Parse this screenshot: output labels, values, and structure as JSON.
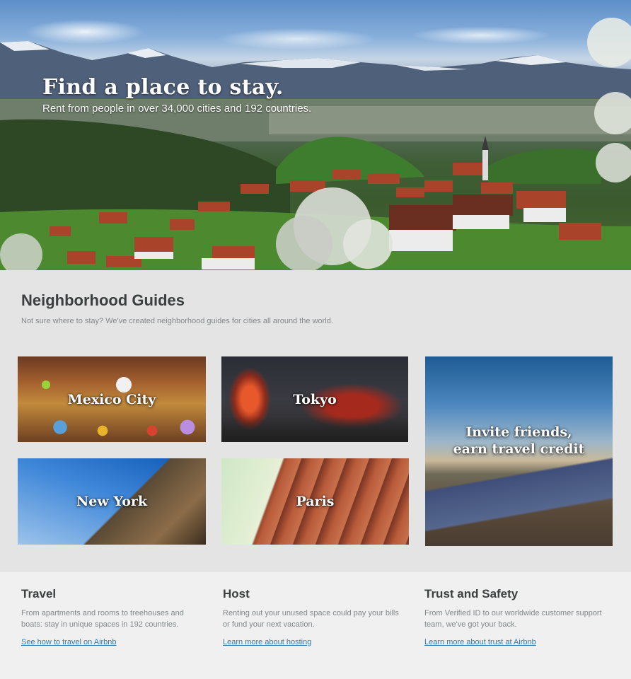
{
  "hero": {
    "title": "Find a place to stay.",
    "subtitle": "Rent from people in over 34,000 cities and 192 countries."
  },
  "neighborhood": {
    "title": "Neighborhood Guides",
    "subtitle": "Not sure where to stay? We've created neighborhood guides for cities all around the world.",
    "tiles": [
      {
        "label": "Mexico City"
      },
      {
        "label": "Tokyo"
      },
      {
        "label": "Invite friends, earn travel credit"
      },
      {
        "label": "New York"
      },
      {
        "label": "Paris"
      }
    ]
  },
  "footer": {
    "columns": [
      {
        "title": "Travel",
        "text": "From apartments and rooms to treehouses and boats: stay in unique spaces in 192 countries.",
        "link": "See how to travel on Airbnb"
      },
      {
        "title": "Host",
        "text": "Renting out your unused space could pay your bills or fund your next vacation.",
        "link": "Learn more about hosting"
      },
      {
        "title": "Trust and Safety",
        "text": "From Verified ID to our worldwide customer support team, we've got your back.",
        "link": "Learn more about trust at Airbnb"
      }
    ]
  }
}
